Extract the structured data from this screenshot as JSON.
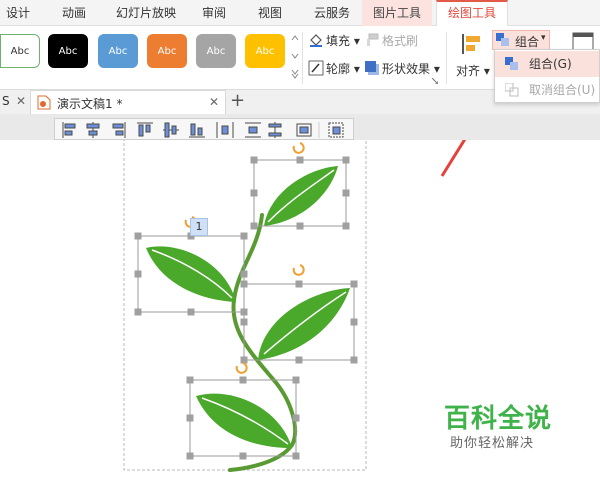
{
  "menu_tabs": [
    {
      "label": "设计"
    },
    {
      "label": "动画"
    },
    {
      "label": "幻灯片放映"
    },
    {
      "label": "审阅"
    },
    {
      "label": "视图"
    },
    {
      "label": "云服务"
    },
    {
      "label": "图片工具"
    },
    {
      "label": "绘图工具"
    }
  ],
  "ribbon": {
    "style_swatches": [
      {
        "label": "Abc",
        "bg": "#ffffff",
        "fg": "#333333",
        "border": "#6fb26f"
      },
      {
        "label": "Abc",
        "bg": "#000000",
        "fg": "#ffffff",
        "border": "#000000"
      },
      {
        "label": "Abc",
        "bg": "#5b9bd5",
        "fg": "#ffffff",
        "border": "#5b9bd5"
      },
      {
        "label": "Abc",
        "bg": "#ed7d31",
        "fg": "#ffffff",
        "border": "#ed7d31"
      },
      {
        "label": "Abc",
        "bg": "#a5a5a5",
        "fg": "#ffffff",
        "border": "#a5a5a5"
      },
      {
        "label": "Abc",
        "bg": "#ffc000",
        "fg": "#ffffff",
        "border": "#ffc000"
      }
    ],
    "fill_label": "填充",
    "format_painter_label": "格式刷",
    "outline_label": "轮廓",
    "shape_effect_label": "形状效果",
    "align_label": "对齐",
    "group_label": "组合"
  },
  "group_menu": {
    "items": [
      {
        "label": "组合(G)"
      },
      {
        "label": "取消组合(U)"
      }
    ]
  },
  "document_tabs": {
    "prev_tab_fragment": "S",
    "current_doc": "演示文稿1 *"
  },
  "selection_badge": "1",
  "watermark": {
    "main": "百科全说",
    "sub": "助你轻松解决"
  },
  "colors": {
    "accent": "#e35b48",
    "context_tab": "#fde3df",
    "leaf_green": "#4aa82a",
    "stem_green": "#5a9a32",
    "handle_gray": "#a0a0a0",
    "arrow_red": "#e8403a"
  }
}
